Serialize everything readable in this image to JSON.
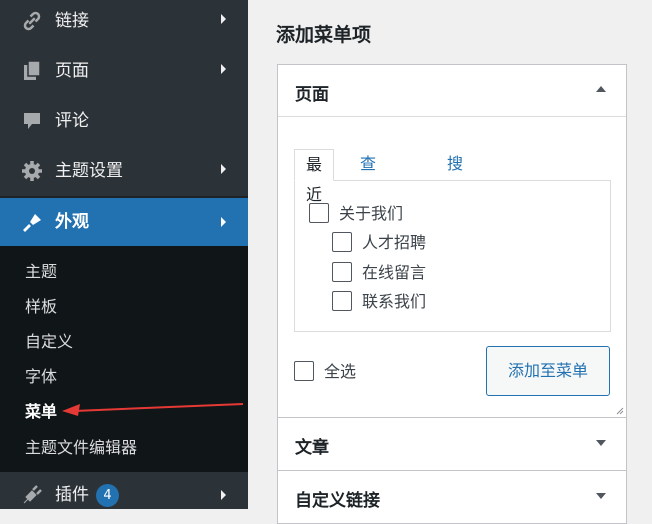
{
  "sidebar": {
    "items": [
      {
        "label": "链接",
        "icon": "link-icon"
      },
      {
        "label": "页面",
        "icon": "pages-icon"
      },
      {
        "label": "评论",
        "icon": "comments-icon"
      },
      {
        "label": "主题设置",
        "icon": "gear-icon"
      }
    ],
    "active": {
      "label": "外观",
      "icon": "appearance-brush-icon"
    },
    "submenu": [
      "主题",
      "样板",
      "自定义",
      "字体",
      "菜单",
      "主题文件编辑器"
    ],
    "current_submenu": "菜单",
    "plugins": {
      "label": "插件",
      "badge": "4",
      "icon": "plugin-icon"
    }
  },
  "main": {
    "title": "添加菜单项",
    "pages_box": {
      "title": "页面",
      "tabs": [
        "最近",
        "查看所有",
        "搜索"
      ],
      "active_tab": "最近",
      "pages": [
        {
          "label": "关于我们",
          "indent": 0,
          "checked": false
        },
        {
          "label": "人才招聘",
          "indent": 1,
          "checked": false
        },
        {
          "label": "在线留言",
          "indent": 1,
          "checked": false
        },
        {
          "label": "联系我们",
          "indent": 1,
          "checked": false
        }
      ],
      "select_all": "全选",
      "add_button": "添加至菜单"
    },
    "collapsed_boxes": [
      "文章",
      "自定义链接"
    ]
  },
  "colors": {
    "accent": "#2271b1",
    "annotation_arrow": "#e53935",
    "sidebar_bg": "#2c3338"
  }
}
